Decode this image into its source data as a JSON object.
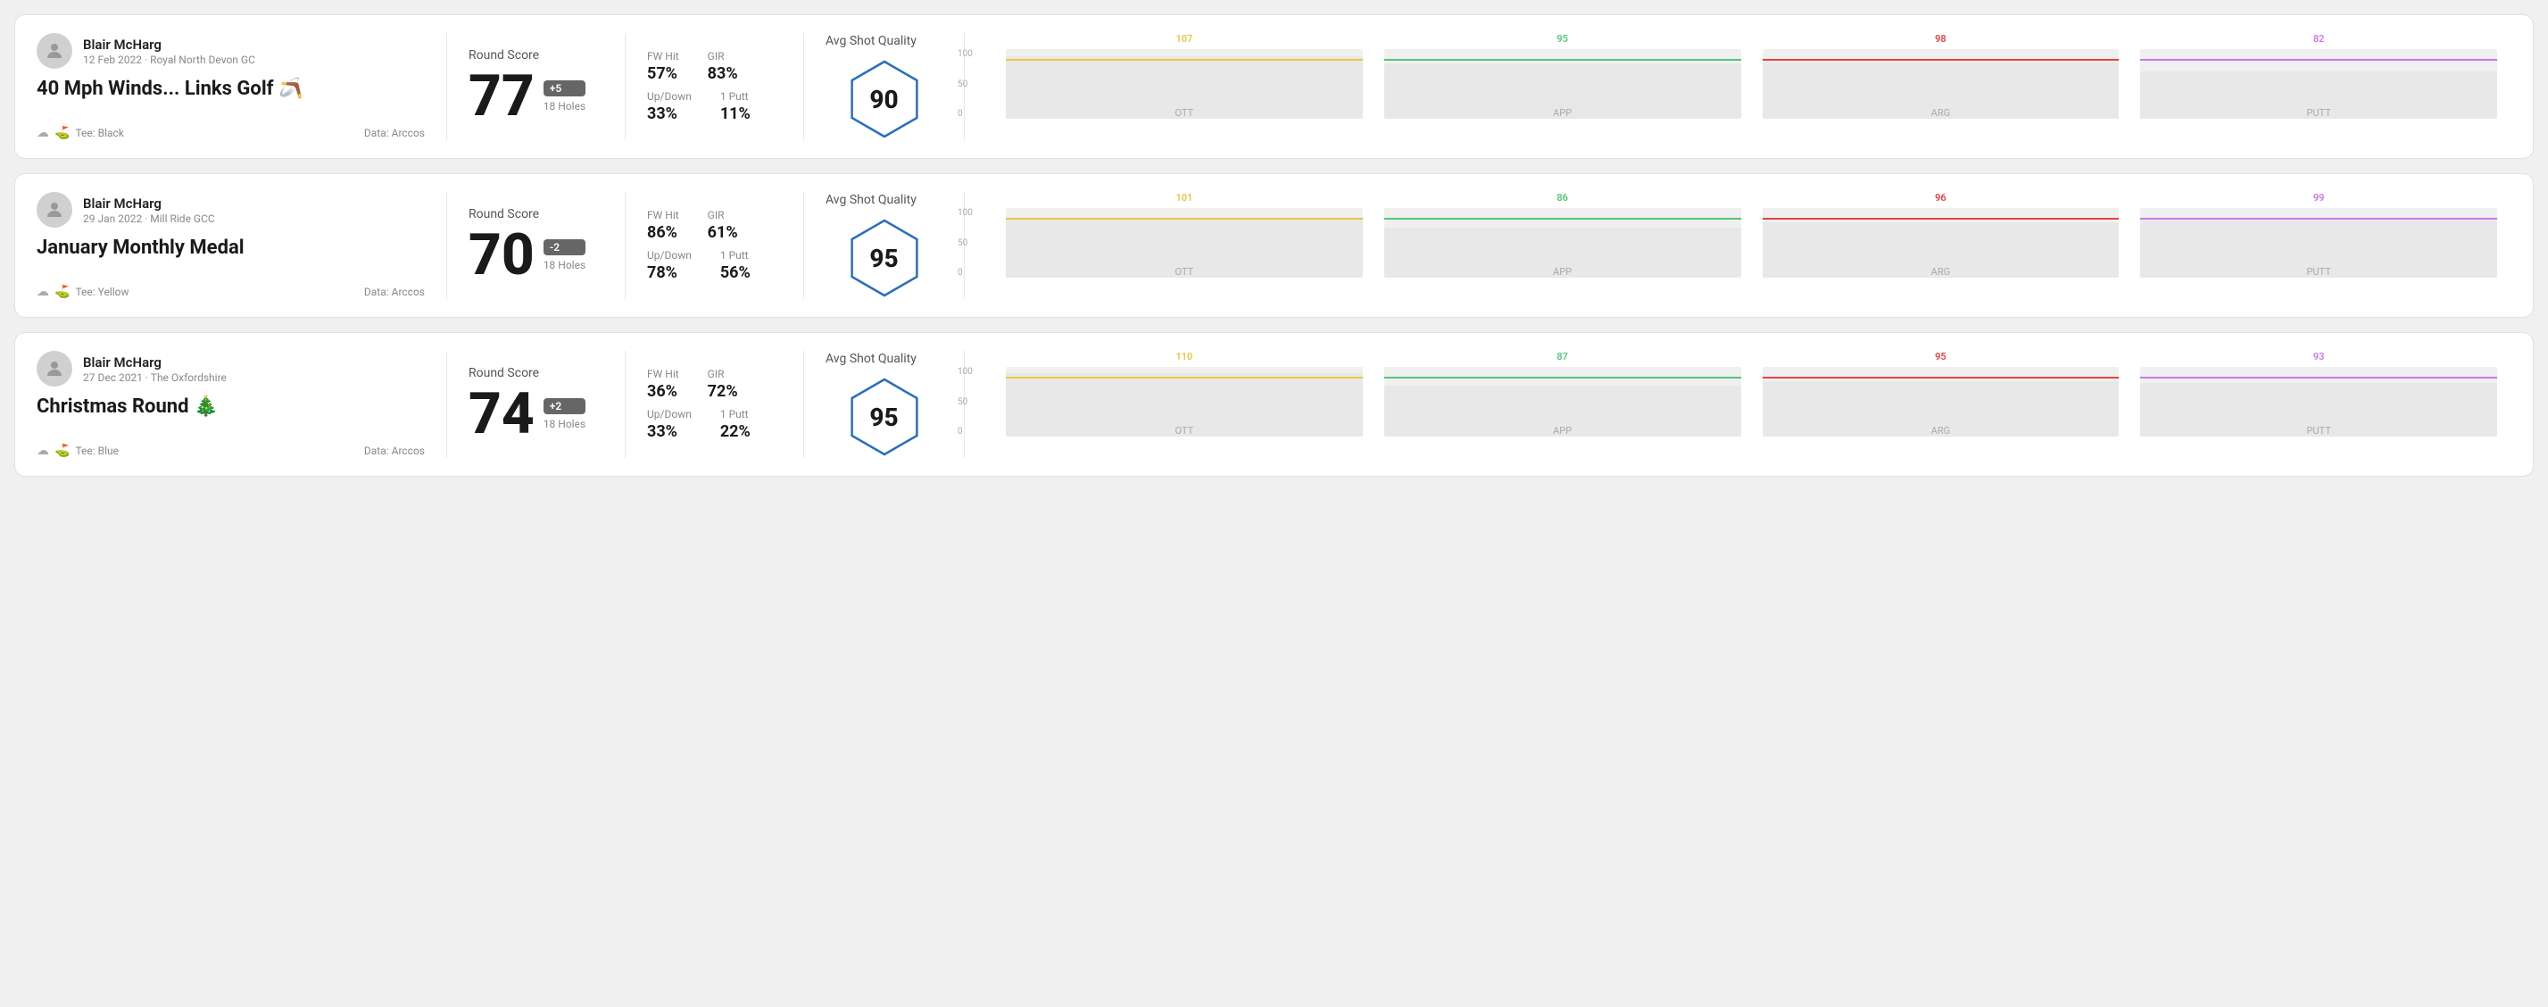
{
  "rounds": [
    {
      "id": "round-1",
      "player_name": "Blair McHarg",
      "date": "12 Feb 2022 · Royal North Devon GC",
      "title": "40 Mph Winds... Links Golf 🪃",
      "tee": "Tee: Black",
      "data_source": "Data: Arccos",
      "score": "77",
      "score_modifier": "+5",
      "holes": "18 Holes",
      "fw_hit": "57%",
      "gir": "83%",
      "up_down": "33%",
      "one_putt": "11%",
      "avg_shot_quality": "90",
      "chart": {
        "bars": [
          {
            "label": "OTT",
            "value": 107,
            "color": "#e8c840",
            "max": 120
          },
          {
            "label": "APP",
            "value": 95,
            "color": "#50c878",
            "max": 120
          },
          {
            "label": "ARG",
            "value": 98,
            "color": "#e84040",
            "max": 120
          },
          {
            "label": "PUTT",
            "value": 82,
            "color": "#c878e8",
            "max": 120
          }
        ]
      }
    },
    {
      "id": "round-2",
      "player_name": "Blair McHarg",
      "date": "29 Jan 2022 · Mill Ride GCC",
      "title": "January Monthly Medal",
      "tee": "Tee: Yellow",
      "data_source": "Data: Arccos",
      "score": "70",
      "score_modifier": "-2",
      "holes": "18 Holes",
      "fw_hit": "86%",
      "gir": "61%",
      "up_down": "78%",
      "one_putt": "56%",
      "avg_shot_quality": "95",
      "chart": {
        "bars": [
          {
            "label": "OTT",
            "value": 101,
            "color": "#e8c840",
            "max": 120
          },
          {
            "label": "APP",
            "value": 86,
            "color": "#50c878",
            "max": 120
          },
          {
            "label": "ARG",
            "value": 96,
            "color": "#e84040",
            "max": 120
          },
          {
            "label": "PUTT",
            "value": 99,
            "color": "#c878e8",
            "max": 120
          }
        ]
      }
    },
    {
      "id": "round-3",
      "player_name": "Blair McHarg",
      "date": "27 Dec 2021 · The Oxfordshire",
      "title": "Christmas Round 🎄",
      "tee": "Tee: Blue",
      "data_source": "Data: Arccos",
      "score": "74",
      "score_modifier": "+2",
      "holes": "18 Holes",
      "fw_hit": "36%",
      "gir": "72%",
      "up_down": "33%",
      "one_putt": "22%",
      "avg_shot_quality": "95",
      "chart": {
        "bars": [
          {
            "label": "OTT",
            "value": 110,
            "color": "#e8c840",
            "max": 120
          },
          {
            "label": "APP",
            "value": 87,
            "color": "#50c878",
            "max": 120
          },
          {
            "label": "ARG",
            "value": 95,
            "color": "#e84040",
            "max": 120
          },
          {
            "label": "PUTT",
            "value": 93,
            "color": "#c878e8",
            "max": 120
          }
        ]
      }
    }
  ],
  "labels": {
    "round_score": "Round Score",
    "fw_hit": "FW Hit",
    "gir": "GIR",
    "up_down": "Up/Down",
    "one_putt": "1 Putt",
    "avg_shot_quality": "Avg Shot Quality",
    "chart_y_100": "100",
    "chart_y_50": "50",
    "chart_y_0": "0"
  }
}
